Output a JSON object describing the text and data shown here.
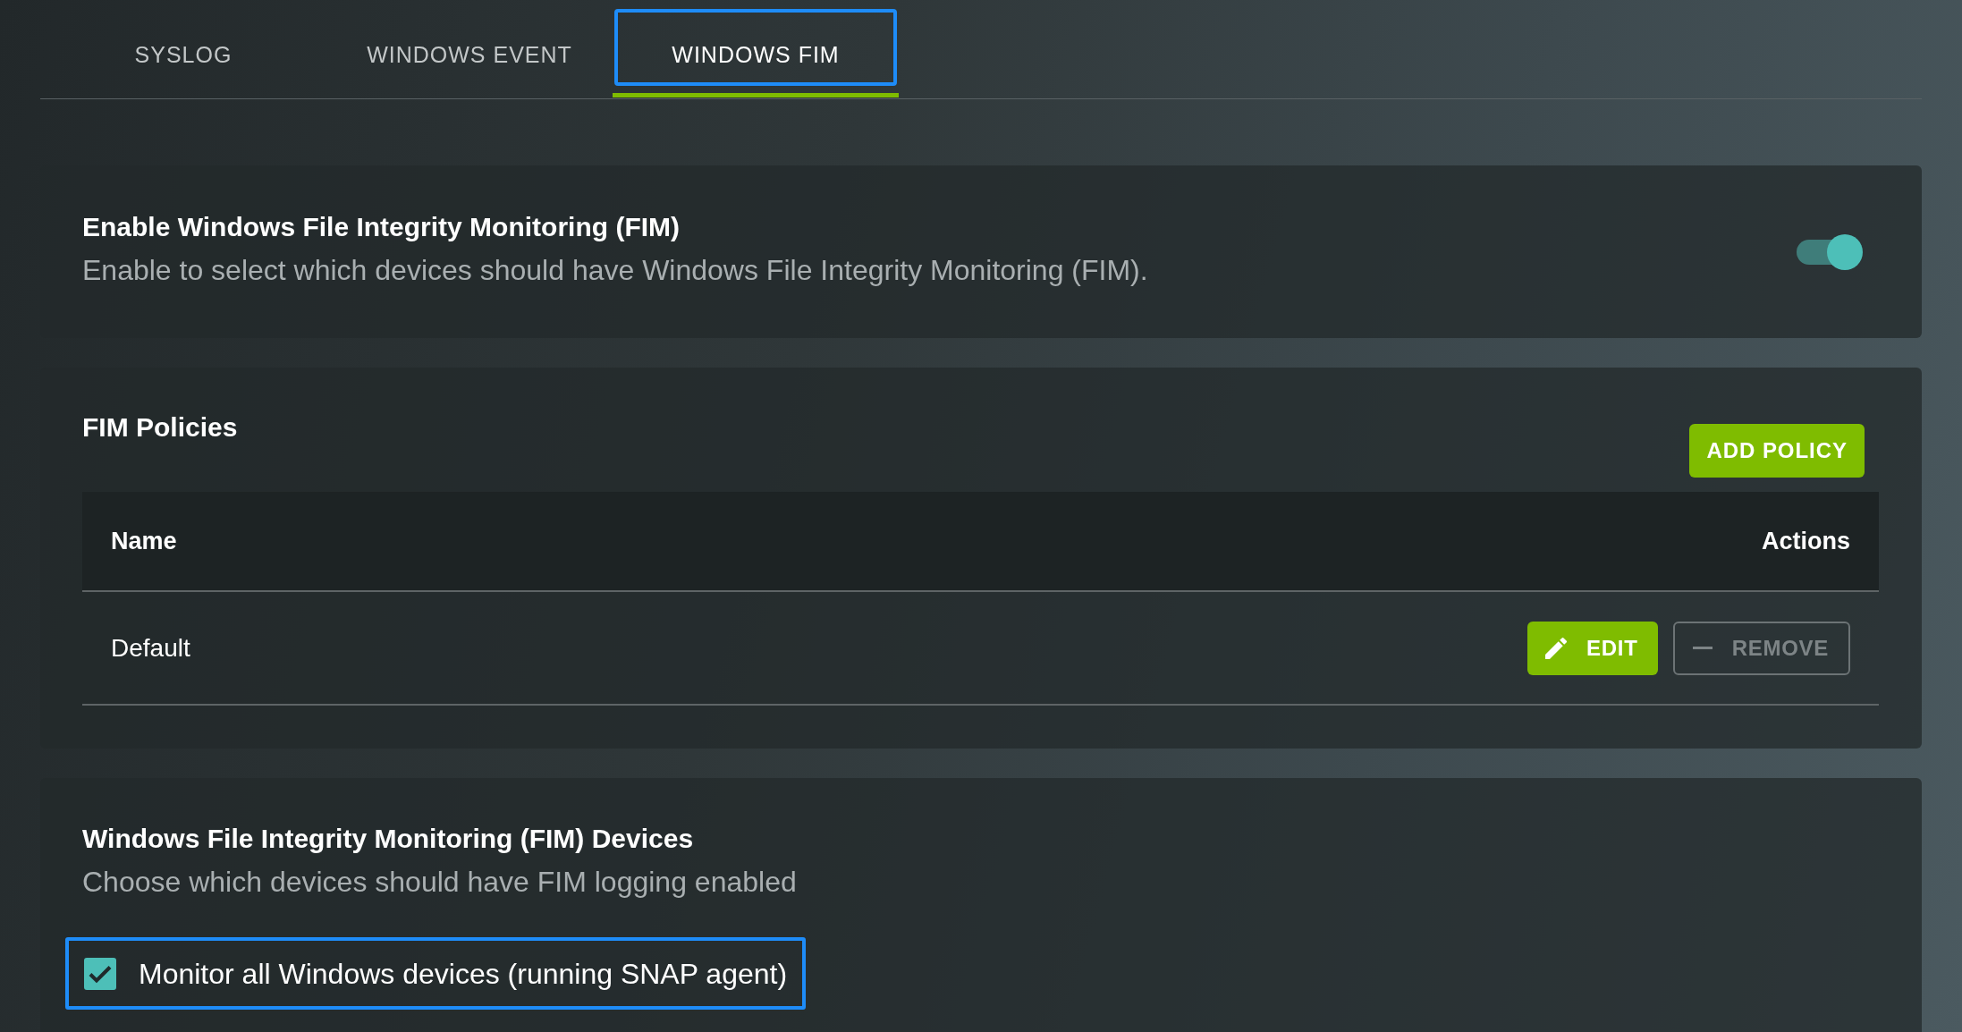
{
  "tabs": [
    {
      "label": "SYSLOG",
      "selected": false,
      "highlighted": false
    },
    {
      "label": "WINDOWS EVENT",
      "selected": false,
      "highlighted": false
    },
    {
      "label": "WINDOWS FIM",
      "selected": true,
      "highlighted": true
    }
  ],
  "fim_toggle": {
    "title": "Enable Windows File Integrity Monitoring (FIM)",
    "description": "Enable to select which devices should have Windows File Integrity Monitoring (FIM).",
    "on": true
  },
  "policies": {
    "title": "FIM Policies",
    "add_button": "ADD POLICY",
    "table": {
      "columns": [
        "Name",
        "Actions"
      ],
      "rows": [
        {
          "name": "Default",
          "actions": [
            {
              "kind": "edit",
              "label": "EDIT",
              "disabled": false
            },
            {
              "kind": "remove",
              "label": "REMOVE",
              "disabled": true
            }
          ]
        }
      ]
    }
  },
  "devices": {
    "title": "Windows File Integrity Monitoring (FIM) Devices",
    "description": "Choose which devices should have FIM logging enabled",
    "options": [
      {
        "label": "Monitor all Windows devices (running SNAP agent)",
        "checked": true,
        "highlighted": true
      }
    ]
  }
}
